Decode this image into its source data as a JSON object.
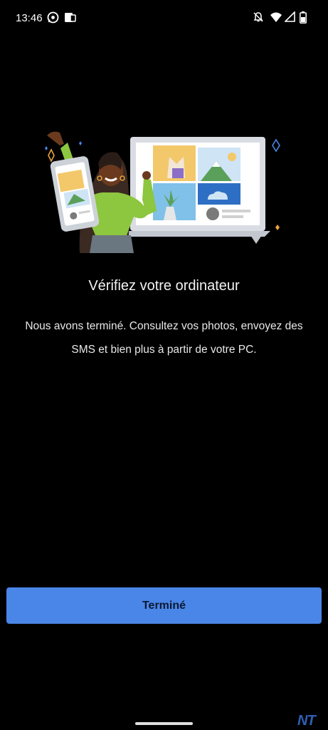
{
  "status_bar": {
    "time": "13:46",
    "left_icons": [
      "whatsapp-icon",
      "screen-cast-icon"
    ],
    "right_icons": [
      "notifications-off-icon",
      "wifi-icon",
      "signal-icon",
      "battery-icon"
    ]
  },
  "illustration": {
    "icons": [
      "woman-waving-illustration",
      "phone-illustration",
      "laptop-illustration",
      "photo-thumbnails"
    ]
  },
  "main": {
    "title": "Vérifiez votre ordinateur",
    "description": "Nous avons terminé. Consultez vos photos, envoyez des SMS et bien plus à partir de votre PC."
  },
  "actions": {
    "done_label": "Terminé"
  },
  "watermark": "NT",
  "colors": {
    "background": "#000000",
    "button": "#4a86e8",
    "button_text": "#0b1a33",
    "accent_green": "#8dc63f"
  }
}
